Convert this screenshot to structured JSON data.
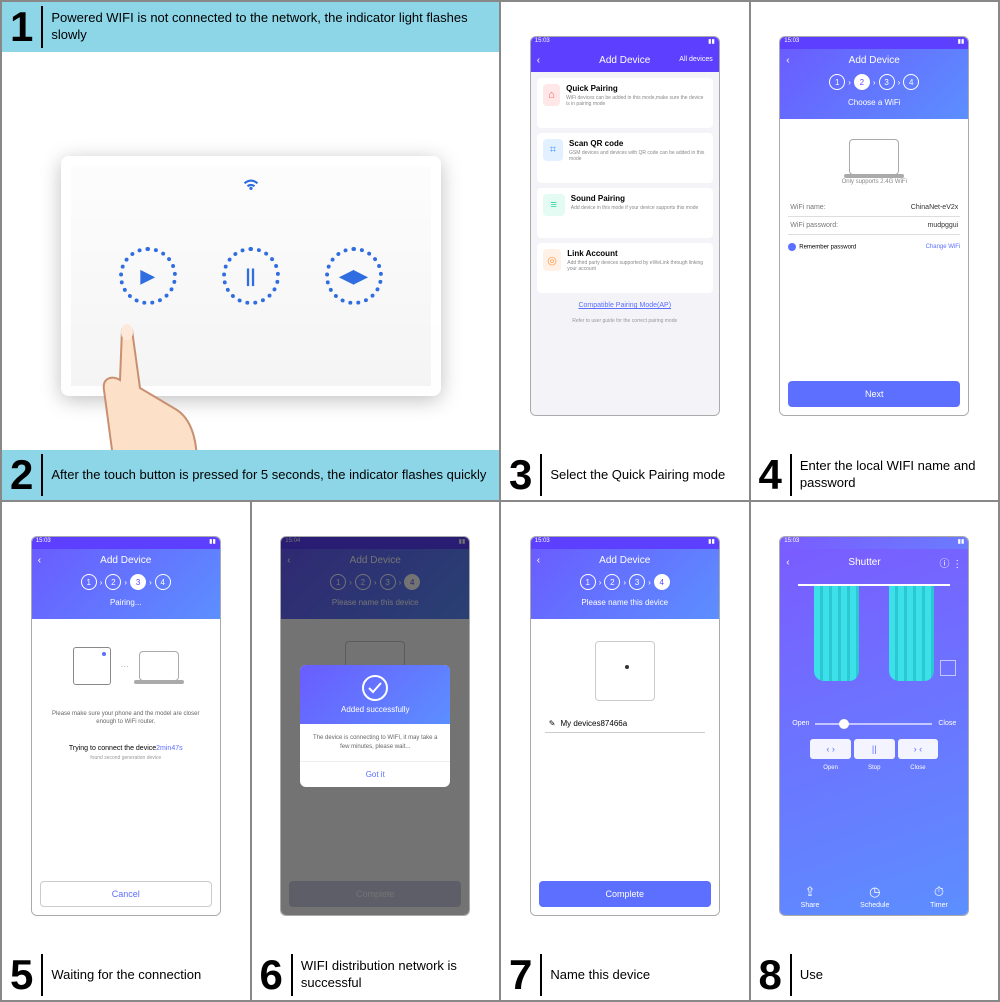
{
  "steps": {
    "s1": {
      "num": "1",
      "text": "Powered WIFI is not connected to the network, the indicator light flashes slowly"
    },
    "s2": {
      "num": "2",
      "text": "After the touch button is pressed for 5 seconds, the indicator flashes quickly"
    },
    "s3": {
      "num": "3",
      "text": "Select the Quick Pairing mode"
    },
    "s4": {
      "num": "4",
      "text": "Enter the local WIFI name and password"
    },
    "s5": {
      "num": "5",
      "text": "Waiting for the connection"
    },
    "s6": {
      "num": "6",
      "text": "WIFI distribution network is successful"
    },
    "s7": {
      "num": "7",
      "text": "Name this device"
    },
    "s8": {
      "num": "8",
      "text": "Use"
    }
  },
  "common": {
    "statusTime": "15:03",
    "addDevice": "Add Device",
    "allDevices": "All devices",
    "back": "‹"
  },
  "screen3": {
    "cards": [
      {
        "title": "Quick Pairing",
        "desc": "WiFi devices can be added in this mode,make sure the device is in pairing mode",
        "iconColor": "#ff5a5a",
        "iconBg": "#ffe7e7",
        "glyph": "⌂"
      },
      {
        "title": "Scan QR code",
        "desc": "GSM devices and devices with QR code can be added in this mode",
        "iconColor": "#4a9cff",
        "iconBg": "#e3f0ff",
        "glyph": "⌗"
      },
      {
        "title": "Sound Pairing",
        "desc": "Add device in this mode if your device supports this mode",
        "iconColor": "#2ed6a0",
        "iconBg": "#e3fbf2",
        "glyph": "≡"
      },
      {
        "title": "Link Account",
        "desc": "Add third party devices supported by eWeLink through linking your account",
        "iconColor": "#ff9a4a",
        "iconBg": "#fff1e6",
        "glyph": "◎"
      }
    ],
    "link": "Compatible Pairing Mode(AP)",
    "foot": "Refer to user guide for the correct pairing mode"
  },
  "screen4": {
    "stepper": [
      "1",
      "2",
      "3",
      "4"
    ],
    "active": 1,
    "subtitle": "Choose a WiFi",
    "note": "Only supports 2.4G WiFi",
    "nameLabel": "WiFi name:",
    "nameValue": "ChinaNet-eV2x",
    "passLabel": "WiFi password:",
    "passValue": "mudpggui",
    "remember": "Remember password",
    "change": "Change WiFi",
    "next": "Next"
  },
  "screen5": {
    "stepper": [
      "1",
      "2",
      "3",
      "4"
    ],
    "active": 2,
    "subtitle": "Pairing...",
    "note": "Please make sure your phone and the model are closer enough to WiFi router.",
    "connectPrefix": "Trying to connect the device",
    "time": "2min47s",
    "found": "found second generation device",
    "cancel": "Cancel"
  },
  "screen6": {
    "statusTime": "15:04",
    "stepper": [
      "1",
      "2",
      "3",
      "4"
    ],
    "active": 3,
    "subtitle": "Please name this device",
    "modalTitle": "Added successfully",
    "modalBody": "The device is connecting to WIFI, it may take a few minutes, please wait...",
    "gotIt": "Got it",
    "complete": "Complete"
  },
  "screen7": {
    "stepper": [
      "1",
      "2",
      "3",
      "4"
    ],
    "active": 3,
    "subtitle": "Please name this device",
    "deviceName": "My devices87466a",
    "complete": "Complete"
  },
  "screen8": {
    "title": "Shutter",
    "info": "ⓘ",
    "menu": "⋮",
    "open": "Open",
    "close": "Close",
    "controls": {
      "open": "‹ ›",
      "stop": "||",
      "closeBtn": "› ‹"
    },
    "labels": {
      "open": "Open",
      "stop": "Stop",
      "close": "Close"
    },
    "nav": [
      {
        "icon": "⇪",
        "label": "Share"
      },
      {
        "icon": "◷",
        "label": "Schedule"
      },
      {
        "icon": "⏱",
        "label": "Timer"
      }
    ]
  }
}
